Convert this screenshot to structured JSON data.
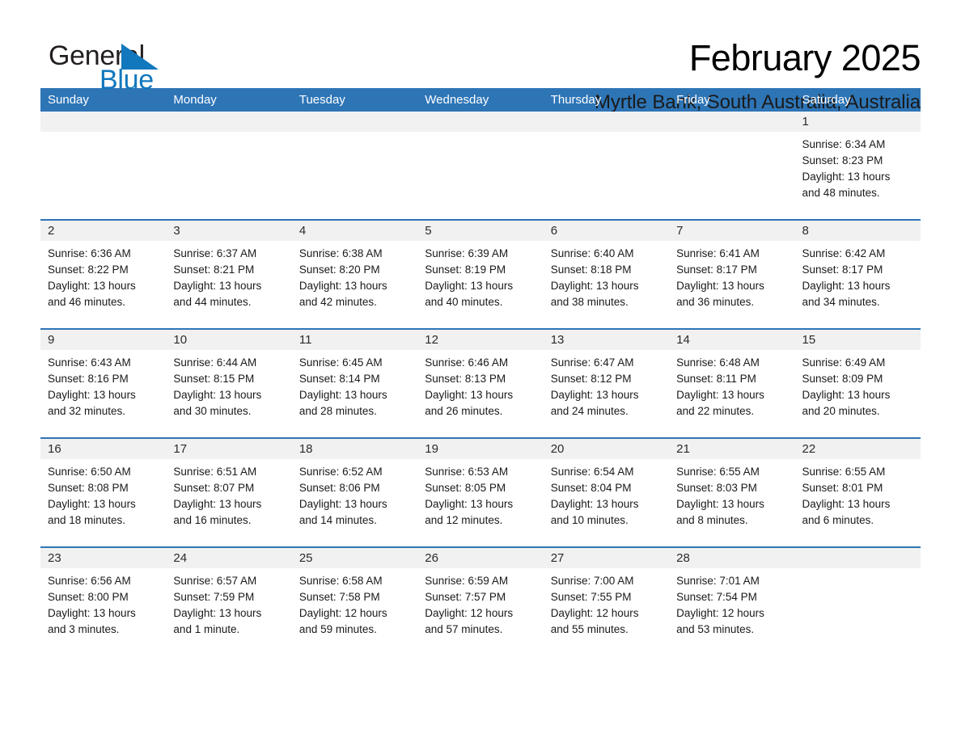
{
  "brand": {
    "name_part1": "General",
    "name_part2": "Blue",
    "triangle_color": "#1278be",
    "accent_color": "#2e75b6"
  },
  "header": {
    "month_title": "February 2025",
    "location": "Myrtle Bank, South Australia, Australia"
  },
  "calendar": {
    "weekdays": [
      "Sunday",
      "Monday",
      "Tuesday",
      "Wednesday",
      "Thursday",
      "Friday",
      "Saturday"
    ],
    "weeks": [
      [
        {
          "day": "",
          "empty": true
        },
        {
          "day": "",
          "empty": true
        },
        {
          "day": "",
          "empty": true
        },
        {
          "day": "",
          "empty": true
        },
        {
          "day": "",
          "empty": true
        },
        {
          "day": "",
          "empty": true
        },
        {
          "day": "1",
          "sunrise": "Sunrise: 6:34 AM",
          "sunset": "Sunset: 8:23 PM",
          "daylight_line1": "Daylight: 13 hours",
          "daylight_line2": "and 48 minutes."
        }
      ],
      [
        {
          "day": "2",
          "sunrise": "Sunrise: 6:36 AM",
          "sunset": "Sunset: 8:22 PM",
          "daylight_line1": "Daylight: 13 hours",
          "daylight_line2": "and 46 minutes."
        },
        {
          "day": "3",
          "sunrise": "Sunrise: 6:37 AM",
          "sunset": "Sunset: 8:21 PM",
          "daylight_line1": "Daylight: 13 hours",
          "daylight_line2": "and 44 minutes."
        },
        {
          "day": "4",
          "sunrise": "Sunrise: 6:38 AM",
          "sunset": "Sunset: 8:20 PM",
          "daylight_line1": "Daylight: 13 hours",
          "daylight_line2": "and 42 minutes."
        },
        {
          "day": "5",
          "sunrise": "Sunrise: 6:39 AM",
          "sunset": "Sunset: 8:19 PM",
          "daylight_line1": "Daylight: 13 hours",
          "daylight_line2": "and 40 minutes."
        },
        {
          "day": "6",
          "sunrise": "Sunrise: 6:40 AM",
          "sunset": "Sunset: 8:18 PM",
          "daylight_line1": "Daylight: 13 hours",
          "daylight_line2": "and 38 minutes."
        },
        {
          "day": "7",
          "sunrise": "Sunrise: 6:41 AM",
          "sunset": "Sunset: 8:17 PM",
          "daylight_line1": "Daylight: 13 hours",
          "daylight_line2": "and 36 minutes."
        },
        {
          "day": "8",
          "sunrise": "Sunrise: 6:42 AM",
          "sunset": "Sunset: 8:17 PM",
          "daylight_line1": "Daylight: 13 hours",
          "daylight_line2": "and 34 minutes."
        }
      ],
      [
        {
          "day": "9",
          "sunrise": "Sunrise: 6:43 AM",
          "sunset": "Sunset: 8:16 PM",
          "daylight_line1": "Daylight: 13 hours",
          "daylight_line2": "and 32 minutes."
        },
        {
          "day": "10",
          "sunrise": "Sunrise: 6:44 AM",
          "sunset": "Sunset: 8:15 PM",
          "daylight_line1": "Daylight: 13 hours",
          "daylight_line2": "and 30 minutes."
        },
        {
          "day": "11",
          "sunrise": "Sunrise: 6:45 AM",
          "sunset": "Sunset: 8:14 PM",
          "daylight_line1": "Daylight: 13 hours",
          "daylight_line2": "and 28 minutes."
        },
        {
          "day": "12",
          "sunrise": "Sunrise: 6:46 AM",
          "sunset": "Sunset: 8:13 PM",
          "daylight_line1": "Daylight: 13 hours",
          "daylight_line2": "and 26 minutes."
        },
        {
          "day": "13",
          "sunrise": "Sunrise: 6:47 AM",
          "sunset": "Sunset: 8:12 PM",
          "daylight_line1": "Daylight: 13 hours",
          "daylight_line2": "and 24 minutes."
        },
        {
          "day": "14",
          "sunrise": "Sunrise: 6:48 AM",
          "sunset": "Sunset: 8:11 PM",
          "daylight_line1": "Daylight: 13 hours",
          "daylight_line2": "and 22 minutes."
        },
        {
          "day": "15",
          "sunrise": "Sunrise: 6:49 AM",
          "sunset": "Sunset: 8:09 PM",
          "daylight_line1": "Daylight: 13 hours",
          "daylight_line2": "and 20 minutes."
        }
      ],
      [
        {
          "day": "16",
          "sunrise": "Sunrise: 6:50 AM",
          "sunset": "Sunset: 8:08 PM",
          "daylight_line1": "Daylight: 13 hours",
          "daylight_line2": "and 18 minutes."
        },
        {
          "day": "17",
          "sunrise": "Sunrise: 6:51 AM",
          "sunset": "Sunset: 8:07 PM",
          "daylight_line1": "Daylight: 13 hours",
          "daylight_line2": "and 16 minutes."
        },
        {
          "day": "18",
          "sunrise": "Sunrise: 6:52 AM",
          "sunset": "Sunset: 8:06 PM",
          "daylight_line1": "Daylight: 13 hours",
          "daylight_line2": "and 14 minutes."
        },
        {
          "day": "19",
          "sunrise": "Sunrise: 6:53 AM",
          "sunset": "Sunset: 8:05 PM",
          "daylight_line1": "Daylight: 13 hours",
          "daylight_line2": "and 12 minutes."
        },
        {
          "day": "20",
          "sunrise": "Sunrise: 6:54 AM",
          "sunset": "Sunset: 8:04 PM",
          "daylight_line1": "Daylight: 13 hours",
          "daylight_line2": "and 10 minutes."
        },
        {
          "day": "21",
          "sunrise": "Sunrise: 6:55 AM",
          "sunset": "Sunset: 8:03 PM",
          "daylight_line1": "Daylight: 13 hours",
          "daylight_line2": "and 8 minutes."
        },
        {
          "day": "22",
          "sunrise": "Sunrise: 6:55 AM",
          "sunset": "Sunset: 8:01 PM",
          "daylight_line1": "Daylight: 13 hours",
          "daylight_line2": "and 6 minutes."
        }
      ],
      [
        {
          "day": "23",
          "sunrise": "Sunrise: 6:56 AM",
          "sunset": "Sunset: 8:00 PM",
          "daylight_line1": "Daylight: 13 hours",
          "daylight_line2": "and 3 minutes."
        },
        {
          "day": "24",
          "sunrise": "Sunrise: 6:57 AM",
          "sunset": "Sunset: 7:59 PM",
          "daylight_line1": "Daylight: 13 hours",
          "daylight_line2": "and 1 minute."
        },
        {
          "day": "25",
          "sunrise": "Sunrise: 6:58 AM",
          "sunset": "Sunset: 7:58 PM",
          "daylight_line1": "Daylight: 12 hours",
          "daylight_line2": "and 59 minutes."
        },
        {
          "day": "26",
          "sunrise": "Sunrise: 6:59 AM",
          "sunset": "Sunset: 7:57 PM",
          "daylight_line1": "Daylight: 12 hours",
          "daylight_line2": "and 57 minutes."
        },
        {
          "day": "27",
          "sunrise": "Sunrise: 7:00 AM",
          "sunset": "Sunset: 7:55 PM",
          "daylight_line1": "Daylight: 12 hours",
          "daylight_line2": "and 55 minutes."
        },
        {
          "day": "28",
          "sunrise": "Sunrise: 7:01 AM",
          "sunset": "Sunset: 7:54 PM",
          "daylight_line1": "Daylight: 12 hours",
          "daylight_line2": "and 53 minutes."
        },
        {
          "day": "",
          "empty": true
        }
      ]
    ]
  }
}
